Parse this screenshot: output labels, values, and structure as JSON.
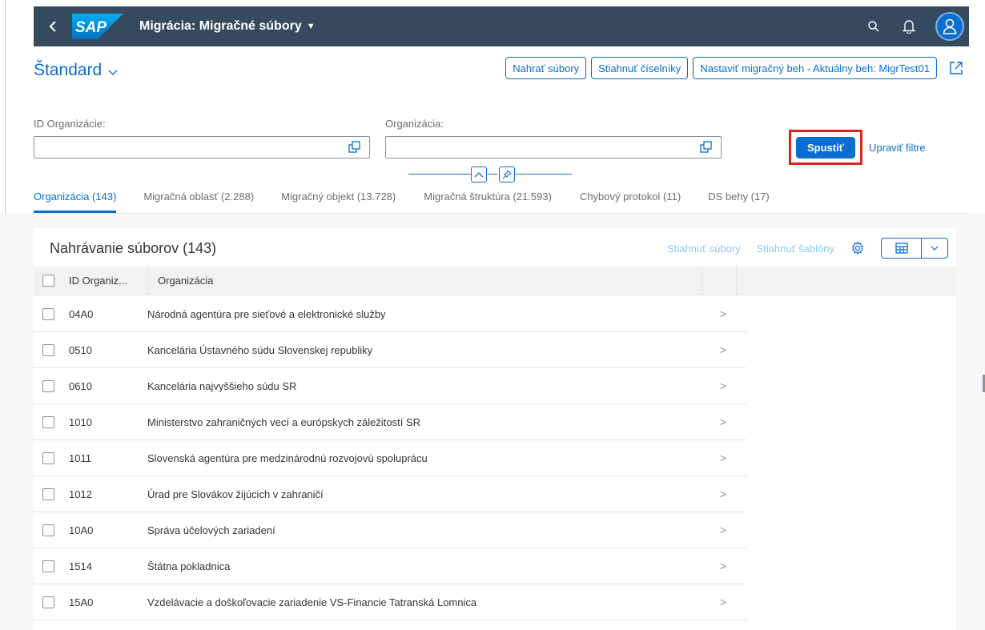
{
  "shell": {
    "logo": "SAP",
    "title": "Migrácia: Migračné súbory"
  },
  "header": {
    "variant": "Štandard",
    "actions": [
      "Nahrať súbory",
      "Stiahnuť číselníky",
      "Nastaviť migračný beh - Aktuálny beh: MigrTest01"
    ]
  },
  "filters": {
    "org_id_label": "ID Organizácie:",
    "org_id_value": "",
    "org_label": "Organizácia:",
    "org_value": "",
    "go_label": "Spustiť",
    "adapt_label": "Upraviť filtre"
  },
  "tabs": [
    {
      "label": "Organizácia (143)",
      "active": true
    },
    {
      "label": "Migračná oblasť (2.288)",
      "active": false
    },
    {
      "label": "Migračný objekt (13.728)",
      "active": false
    },
    {
      "label": "Migračná štruktúra (21.593)",
      "active": false
    },
    {
      "label": "Chybový protokol (11)",
      "active": false
    },
    {
      "label": "DS behy (17)",
      "active": false
    }
  ],
  "table": {
    "title": "Nahrávanie súborov (143)",
    "download_files": "Stiahnuť súbory",
    "download_templates": "Stiahnuť šablóny",
    "columns": [
      "ID Organiz...",
      "Organizácia"
    ],
    "rows": [
      {
        "id": "04A0",
        "org": "Národná agentúra pre sieťové a elektronické služby"
      },
      {
        "id": "0510",
        "org": "Kancelária Ústavného súdu Slovenskej republiky"
      },
      {
        "id": "0610",
        "org": "Kancelária najvyššieho súdu SR"
      },
      {
        "id": "1010",
        "org": "Ministerstvo zahraničných vecí a európskych záležitostí SR"
      },
      {
        "id": "1011",
        "org": "Slovenská agentúra pre medzinárodnú rozvojovú spoluprácu"
      },
      {
        "id": "1012",
        "org": "Úrad pre Slovákov žijúcich v zahraničí"
      },
      {
        "id": "10A0",
        "org": "Správa účelových zariadení"
      },
      {
        "id": "1514",
        "org": "Štátna pokladnica"
      },
      {
        "id": "15A0",
        "org": "Vzdelávacie a doškoľovacie zariadenie VS-Financie Tatranská Lomnica"
      }
    ]
  },
  "colors": {
    "shell": "#354a5f",
    "accent": "#0a6ed1",
    "highlight": "#d9251c"
  }
}
